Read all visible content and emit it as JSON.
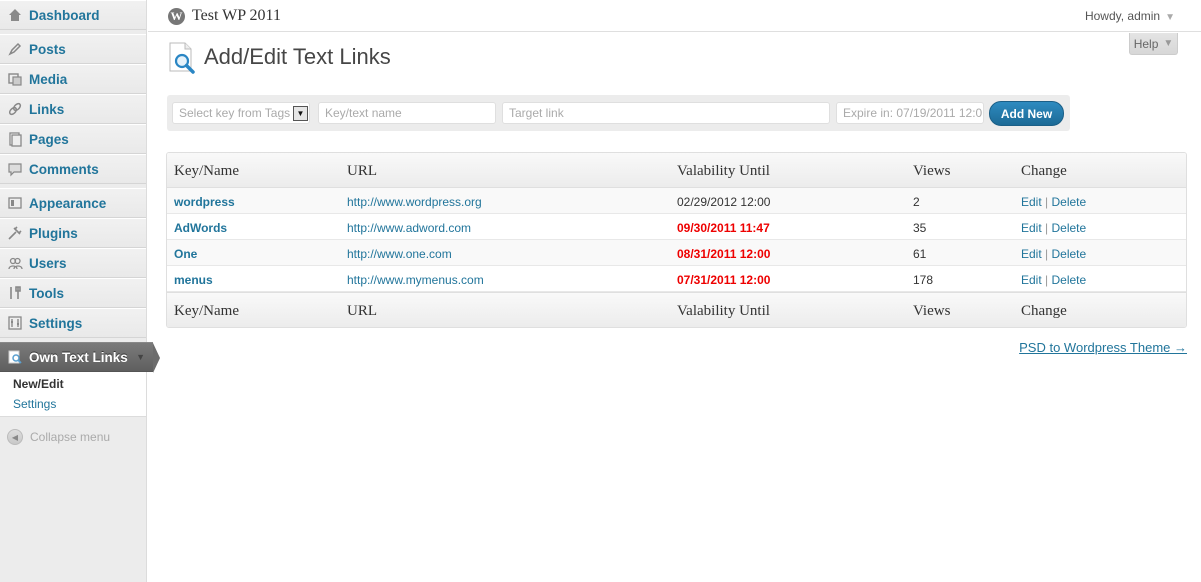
{
  "sidebar": {
    "items": [
      {
        "label": "Dashboard",
        "icon": "dashboard-icon"
      },
      {
        "label": "Posts",
        "icon": "posts-icon"
      },
      {
        "label": "Media",
        "icon": "media-icon"
      },
      {
        "label": "Links",
        "icon": "links-icon"
      },
      {
        "label": "Pages",
        "icon": "pages-icon"
      },
      {
        "label": "Comments",
        "icon": "comments-icon"
      },
      {
        "label": "Appearance",
        "icon": "appearance-icon"
      },
      {
        "label": "Plugins",
        "icon": "plugins-icon"
      },
      {
        "label": "Users",
        "icon": "users-icon"
      },
      {
        "label": "Tools",
        "icon": "tools-icon"
      },
      {
        "label": "Settings",
        "icon": "settings-icon"
      },
      {
        "label": "Own Text Links",
        "icon": "text-links-icon"
      }
    ],
    "submenu": [
      {
        "label": "New/Edit"
      },
      {
        "label": "Settings"
      }
    ],
    "collapse_label": "Collapse menu"
  },
  "header": {
    "site_title": "Test WP 2011",
    "howdy": "Howdy, admin",
    "help": "Help"
  },
  "page": {
    "title": "Add/Edit Text Links"
  },
  "form": {
    "select_placeholder": "Select key from Tags",
    "key_placeholder": "Key/text name",
    "target_placeholder": "Target link",
    "expire_placeholder": "Expire in: 07/19/2011 12:0",
    "add_button": "Add New"
  },
  "table": {
    "headers": [
      "Key/Name",
      "URL",
      "Valability Until",
      "Views",
      "Change"
    ],
    "rows": [
      {
        "key": "wordpress",
        "url": "http://www.wordpress.org",
        "until": "02/29/2012 12:00",
        "expired": false,
        "views": "2"
      },
      {
        "key": "AdWords",
        "url": "http://www.adword.com",
        "until": "09/30/2011 11:47",
        "expired": true,
        "views": "35"
      },
      {
        "key": "One",
        "url": "http://www.one.com",
        "until": "08/31/2011 12:00",
        "expired": true,
        "views": "61"
      },
      {
        "key": "menus",
        "url": "http://www.mymenus.com",
        "until": "07/31/2011 12:00",
        "expired": true,
        "views": "178"
      }
    ],
    "edit_label": "Edit",
    "sep": "|",
    "delete_label": "Delete"
  },
  "footer_link": "PSD to Wordpress Theme →",
  "colors": {
    "link": "#21759b",
    "expired": "#e00000",
    "button": "#2e8bc0"
  }
}
